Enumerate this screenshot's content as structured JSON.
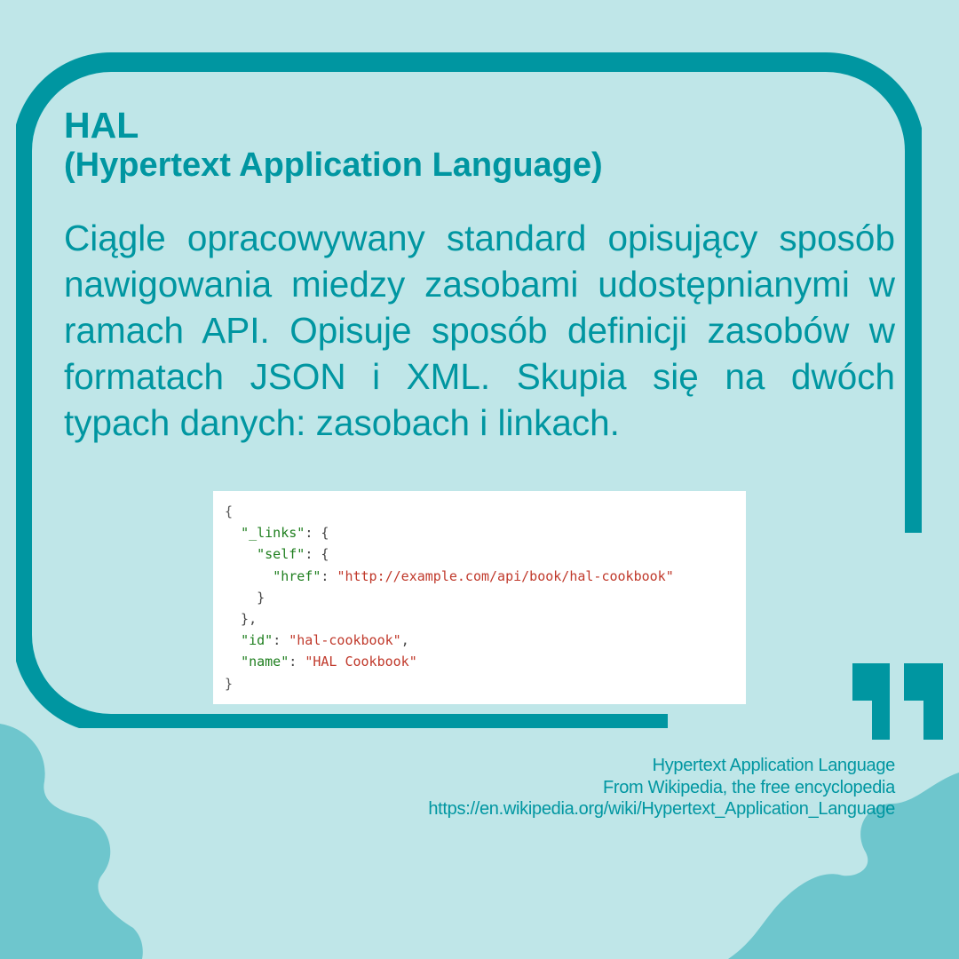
{
  "header": {
    "title": "HAL",
    "subtitle_parts": [
      {
        "text": "(",
        "bold": false
      },
      {
        "text": "H",
        "bold": true
      },
      {
        "text": "ypertext ",
        "bold": false
      },
      {
        "text": "A",
        "bold": true
      },
      {
        "text": "pplication ",
        "bold": false
      },
      {
        "text": "L",
        "bold": true
      },
      {
        "text": "anguage)",
        "bold": false
      }
    ]
  },
  "description": "Ciągle opracowywany standard opisujący sposób nawigowania miedzy zasobami udostępnianymi w ramach API. Opisuje sposób definicji zasobów w formatach JSON i XML. Skupia się na dwóch typach danych: zasobach i linkach.",
  "code_example": {
    "open_brace": "{",
    "links_key": "\"_links\"",
    "self_key": "\"self\"",
    "href_key": "\"href\"",
    "href_value": "\"http://example.com/api/book/hal-cookbook\"",
    "id_key": "\"id\"",
    "id_value": "\"hal-cookbook\"",
    "name_key": "\"name\"",
    "name_value": "\"HAL Cookbook\"",
    "close_brace": "}"
  },
  "source": {
    "line1": "Hypertext Application Language",
    "line2": "From Wikipedia, the free encyclopedia",
    "line3": "https://en.wikipedia.org/wiki/Hypertext_Application_Language"
  },
  "colors": {
    "background": "#bfe6e8",
    "accent": "#0096a1",
    "blob": "#6ec6cd"
  },
  "icons": {
    "quote": "closing-quote-icon"
  }
}
